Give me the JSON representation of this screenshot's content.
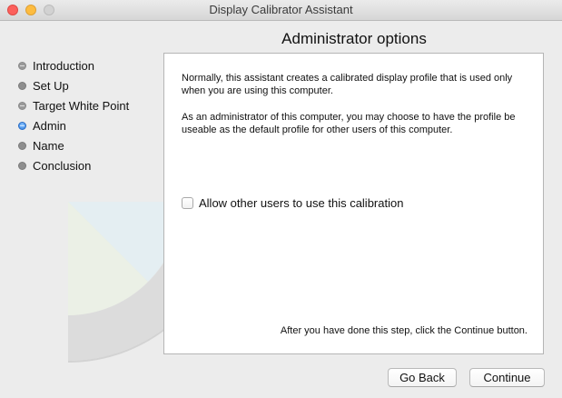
{
  "window": {
    "title": "Display Calibrator Assistant",
    "controls": [
      "close",
      "minimize",
      "zoom"
    ]
  },
  "page": {
    "heading": "Administrator options"
  },
  "steps": [
    {
      "label": "Introduction",
      "state": "done"
    },
    {
      "label": "Set Up",
      "state": "todo"
    },
    {
      "label": "Target White Point",
      "state": "done"
    },
    {
      "label": "Admin",
      "state": "current"
    },
    {
      "label": "Name",
      "state": "todo"
    },
    {
      "label": "Conclusion",
      "state": "todo"
    }
  ],
  "content": {
    "paragraph1": "Normally, this assistant creates a calibrated display profile that is used only when you are using this computer.",
    "paragraph2": "As an administrator of this computer, you may choose to have the profile be useable as the default profile for other users of this computer.",
    "checkbox": {
      "label": "Allow other users to use this calibration",
      "checked": false
    },
    "hint": "After you have done this step, click the Continue button."
  },
  "buttons": {
    "back": "Go Back",
    "continue": "Continue"
  },
  "colors": {
    "close": "#fc605c",
    "minimize": "#fdbc40",
    "zoom_disabled": "#d2d2d2",
    "current_step": "#2f7fe0",
    "window_bg": "#ececec"
  }
}
